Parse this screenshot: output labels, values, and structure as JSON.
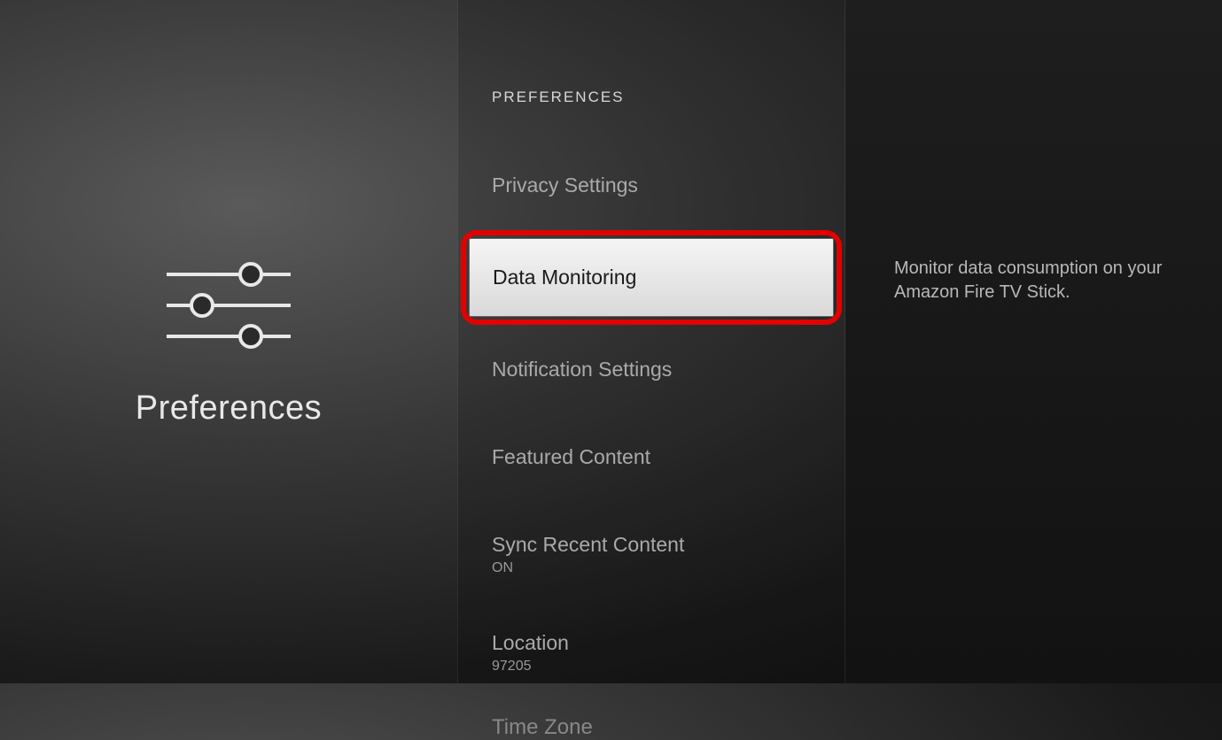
{
  "leftPanel": {
    "title": "Preferences"
  },
  "header": {
    "label": "PREFERENCES"
  },
  "menu": {
    "items": [
      {
        "label": "Privacy Settings",
        "sub": null,
        "selected": false
      },
      {
        "label": "Data Monitoring",
        "sub": null,
        "selected": true
      },
      {
        "label": "Notification Settings",
        "sub": null,
        "selected": false
      },
      {
        "label": "Featured Content",
        "sub": null,
        "selected": false
      },
      {
        "label": "Sync Recent Content",
        "sub": "ON",
        "selected": false
      },
      {
        "label": "Location",
        "sub": "97205",
        "selected": false
      }
    ],
    "cutoffLabel": "Time Zone"
  },
  "detail": {
    "description": "Monitor data consumption on your Amazon Fire TV Stick."
  },
  "annotation": {
    "highlightColor": "#e20000"
  }
}
